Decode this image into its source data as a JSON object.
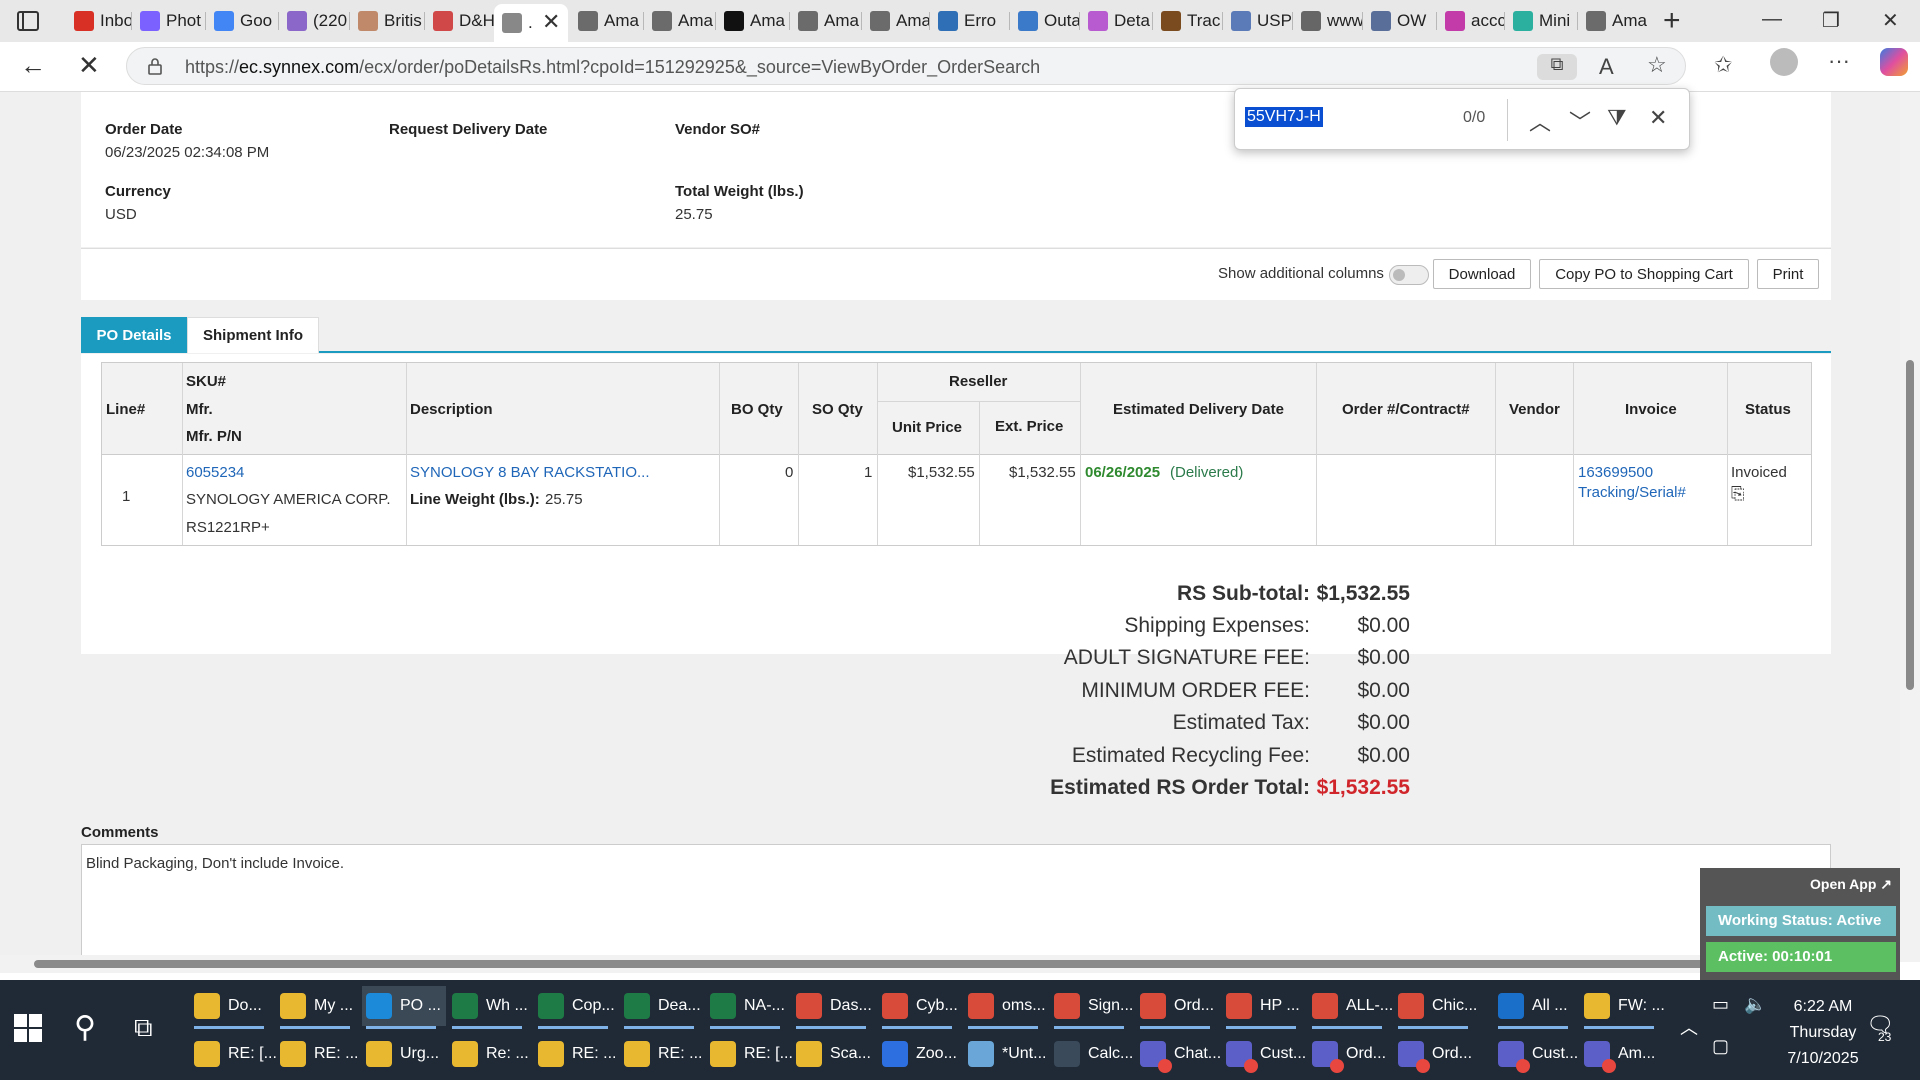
{
  "browser": {
    "tabs": [
      {
        "label": "Inbo",
        "fav": "gmail-icon",
        "color": "#d93025"
      },
      {
        "label": "Phot",
        "fav": "photos-icon",
        "color": "#7b61ff"
      },
      {
        "label": "Goo",
        "fav": "google-icon",
        "color": "#4285f4"
      },
      {
        "label": "(220",
        "fav": "mail-icon",
        "color": "#8a67c8"
      },
      {
        "label": "Britis",
        "fav": "british-icon",
        "color": "#c08a6a"
      },
      {
        "label": "D&H",
        "fav": "dh-icon",
        "color": "#d04848"
      },
      {
        "label": ".",
        "fav": "page-icon",
        "color": "#888888"
      },
      {
        "label": "Ama",
        "fav": "amazon-icon",
        "color": "#6b6b6b"
      },
      {
        "label": "Ama",
        "fav": "amazon-icon",
        "color": "#6b6b6b"
      },
      {
        "label": "Ama",
        "fav": "amazon-a-icon",
        "color": "#111111"
      },
      {
        "label": "Ama",
        "fav": "amazon-icon",
        "color": "#6b6b6b"
      },
      {
        "label": "Ama",
        "fav": "amazon-icon",
        "color": "#6b6b6b"
      },
      {
        "label": "Erro",
        "fav": "dell-icon",
        "color": "#2f6fb5"
      },
      {
        "label": "Outa",
        "fav": "outage-icon",
        "color": "#3b7ac9"
      },
      {
        "label": "Deta",
        "fav": "fedex-icon",
        "color": "#b85ad0"
      },
      {
        "label": "Trac",
        "fav": "ups-icon",
        "color": "#7a4b1f"
      },
      {
        "label": "USP",
        "fav": "usps-icon",
        "color": "#5a7ab8"
      },
      {
        "label": "www",
        "fav": "globe-icon",
        "color": "#666666"
      },
      {
        "label": "OW",
        "fav": "cloud-icon",
        "color": "#5a6e9a"
      },
      {
        "label": "accc",
        "fav": "dots-icon",
        "color": "#c23ba8"
      },
      {
        "label": "Mini",
        "fav": "mini-icon",
        "color": "#2bb0a0"
      },
      {
        "label": "Ama",
        "fav": "amazon-icon",
        "color": "#6b6b6b"
      }
    ],
    "url_prefix": "https://",
    "url_domain": "ec.synnex.com",
    "url_path": "/ecx/order/poDetailsRs.html?cpoId=151292925&_source=ViewByOrder_OrderSearch"
  },
  "find": {
    "query": "55VH7J-H",
    "count": "0/0"
  },
  "order": {
    "order_date_label": "Order Date",
    "order_date": "06/23/2025 02:34:08 PM",
    "request_delivery_label": "Request Delivery Date",
    "vendor_so_label": "Vendor SO#",
    "currency_label": "Currency",
    "currency": "USD",
    "weight_label": "Total Weight (lbs.)",
    "weight": "25.75"
  },
  "toolbar": {
    "show_cols": "Show additional columns",
    "download": "Download",
    "copy_po": "Copy PO to Shopping Cart",
    "print": "Print"
  },
  "tabs": {
    "po_details": "PO Details",
    "shipment_info": "Shipment Info"
  },
  "table": {
    "headers": {
      "line": "Line#",
      "sku": "SKU#",
      "mfr": "Mfr.",
      "mfr_pn": "Mfr. P/N",
      "description": "Description",
      "bo_qty": "BO Qty",
      "so_qty": "SO Qty",
      "reseller": "Reseller",
      "unit_price": "Unit Price",
      "ext_price": "Ext. Price",
      "est_delivery": "Estimated Delivery Date",
      "order_contract": "Order #/Contract#",
      "vendor": "Vendor",
      "invoice": "Invoice",
      "status": "Status"
    },
    "rows": [
      {
        "line": "1",
        "sku": "6055234",
        "mfr": "SYNOLOGY AMERICA CORP.",
        "mfr_pn": "RS1221RP+",
        "description": "SYNOLOGY 8 BAY RACKSTATIO...",
        "line_weight_label": "Line Weight (lbs.):",
        "line_weight": "25.75",
        "bo_qty": "0",
        "so_qty": "1",
        "unit_price": "$1,532.55",
        "ext_price": "$1,532.55",
        "delivery_date": "06/26/2025",
        "delivery_status": "(Delivered)",
        "invoice": "163699500",
        "tracking": "Tracking/Serial#",
        "status": "Invoiced"
      }
    ]
  },
  "totals": [
    {
      "label": "RS Sub-total:",
      "value": "$1,532.55",
      "bold": true
    },
    {
      "label": "Shipping Expenses:",
      "value": "$0.00"
    },
    {
      "label": "ADULT SIGNATURE FEE:",
      "value": "$0.00"
    },
    {
      "label": "MINIMUM ORDER FEE:",
      "value": "$0.00"
    },
    {
      "label": "Estimated Tax:",
      "value": "$0.00"
    },
    {
      "label": "Estimated Recycling Fee:",
      "value": "$0.00"
    },
    {
      "label": "Estimated RS Order Total:",
      "value": "$1,532.55",
      "bold": true,
      "red": true
    }
  ],
  "comments": {
    "label": "Comments",
    "text": "Blind Packaging, Don't include Invoice."
  },
  "widget": {
    "open_app": "Open App ↗",
    "working_status": "Working Status: Active",
    "active_time": "Active: 00:10:01"
  },
  "taskbar": {
    "row1": [
      {
        "label": "Do...",
        "icon": "folder-icon",
        "color": "#e8b830"
      },
      {
        "label": "My ...",
        "icon": "folder-icon",
        "color": "#e8b830"
      },
      {
        "label": "PO ...",
        "icon": "edge-icon",
        "color": "#1c8ad8",
        "active": true
      },
      {
        "label": "Wh ...",
        "icon": "excel-icon",
        "color": "#1e7b45"
      },
      {
        "label": "Cop...",
        "icon": "excel-icon",
        "color": "#1e7b45"
      },
      {
        "label": "Dea...",
        "icon": "excel-icon",
        "color": "#1e7b45"
      },
      {
        "label": "NA-...",
        "icon": "excel-icon",
        "color": "#1e7b45"
      },
      {
        "label": "Das...",
        "icon": "chrome-icon",
        "color": "#d84a3a"
      },
      {
        "label": "Cyb...",
        "icon": "chrome-icon",
        "color": "#d84a3a"
      },
      {
        "label": "oms...",
        "icon": "chrome-icon",
        "color": "#d84a3a"
      },
      {
        "label": "Sign...",
        "icon": "chrome-icon",
        "color": "#d84a3a"
      },
      {
        "label": "Ord...",
        "icon": "chrome-icon",
        "color": "#d84a3a"
      },
      {
        "label": "HP ...",
        "icon": "chrome-icon",
        "color": "#d84a3a"
      },
      {
        "label": "ALL-...",
        "icon": "chrome-icon",
        "color": "#d84a3a"
      },
      {
        "label": "Chic...",
        "icon": "chrome-icon",
        "color": "#d84a3a"
      },
      {
        "label": "All ...",
        "icon": "outlook-icon",
        "color": "#1a6fc9"
      },
      {
        "label": "FW: ...",
        "icon": "mail-icon",
        "color": "#e8b830"
      }
    ],
    "row2": [
      {
        "label": "RE: [...",
        "icon": "mail-icon",
        "color": "#e8b830"
      },
      {
        "label": "RE: ...",
        "icon": "mail-icon",
        "color": "#e8b830"
      },
      {
        "label": "Urg...",
        "icon": "mail-icon",
        "color": "#e8b830"
      },
      {
        "label": "Re: ...",
        "icon": "mail-icon",
        "color": "#e8b830"
      },
      {
        "label": "RE: ...",
        "icon": "mail-icon",
        "color": "#e8b830"
      },
      {
        "label": "RE: ...",
        "icon": "mail-icon",
        "color": "#e8b830"
      },
      {
        "label": "RE: [...",
        "icon": "mail-icon",
        "color": "#e8b830"
      },
      {
        "label": "Sca...",
        "icon": "mail-icon",
        "color": "#e8b830"
      },
      {
        "label": "Zoo...",
        "icon": "zoom-icon",
        "color": "#2d6fe0"
      },
      {
        "label": "*Unt...",
        "icon": "notepad-icon",
        "color": "#6aa6d8"
      },
      {
        "label": "Calc...",
        "icon": "calculator-icon",
        "color": "#3a4a5a"
      },
      {
        "label": "Chat...",
        "icon": "teams-icon",
        "color": "#5b5fc7"
      },
      {
        "label": "Cust...",
        "icon": "teams-icon",
        "color": "#5b5fc7"
      },
      {
        "label": "Ord...",
        "icon": "teams-icon",
        "color": "#5b5fc7"
      },
      {
        "label": "Ord...",
        "icon": "teams-icon",
        "color": "#5b5fc7"
      },
      {
        "label": "Cust...",
        "icon": "teams-icon",
        "color": "#5b5fc7"
      },
      {
        "label": "Am...",
        "icon": "teams-icon",
        "color": "#5b5fc7"
      }
    ],
    "time": "6:22 AM",
    "day": "Thursday",
    "date": "7/10/2025",
    "notif_count": "23"
  }
}
